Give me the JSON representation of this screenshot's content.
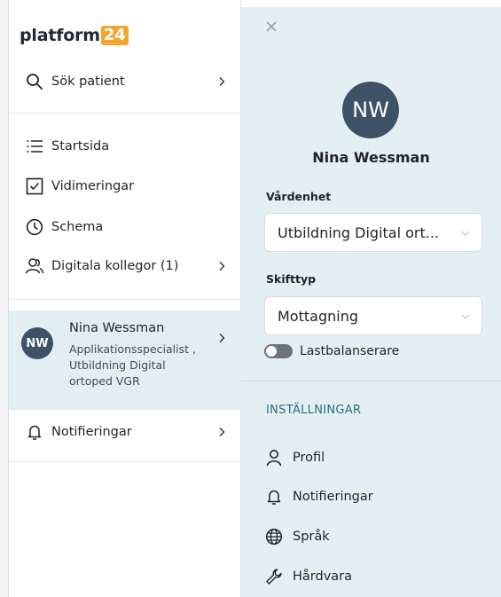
{
  "logo": {
    "text": "platform",
    "badge": "24"
  },
  "nav": {
    "search": {
      "label": "Sök patient",
      "icon": "search-icon"
    },
    "items": [
      {
        "label": "Startsida",
        "icon": "list-icon"
      },
      {
        "label": "Vidimeringar",
        "icon": "checkbox-icon"
      },
      {
        "label": "Schema",
        "icon": "clock-icon"
      },
      {
        "label": "Digitala kollegor (1)",
        "icon": "people-icon"
      }
    ],
    "user": {
      "initials": "NW",
      "name": "Nina Wessman",
      "role": "Applikationsspecialist , Utbildning Digital ortoped VGR"
    },
    "notifications": {
      "label": "Notifieringar",
      "icon": "bell-icon"
    }
  },
  "panel": {
    "initials": "NW",
    "name": "Nina Wessman",
    "unit": {
      "label": "Vårdenhet",
      "value": "Utbildning Digital ort..."
    },
    "shift": {
      "label": "Skifttyp",
      "value": "Mottagning"
    },
    "load_balancer": {
      "label": "Lastbalanserare",
      "on": false
    },
    "settings": {
      "heading": "INSTÄLLNINGAR",
      "items": [
        {
          "label": "Profil",
          "icon": "person-icon"
        },
        {
          "label": "Notifieringar",
          "icon": "bell-icon"
        },
        {
          "label": "Språk",
          "icon": "globe-icon"
        },
        {
          "label": "Hårdvara",
          "icon": "wrench-icon"
        }
      ]
    }
  },
  "colors": {
    "accent": "#f4a52b",
    "avatar": "#3e5266",
    "panel_bg": "#e4eff3",
    "selected_bg": "#e2eef2",
    "section_heading": "#2c6f7a"
  }
}
